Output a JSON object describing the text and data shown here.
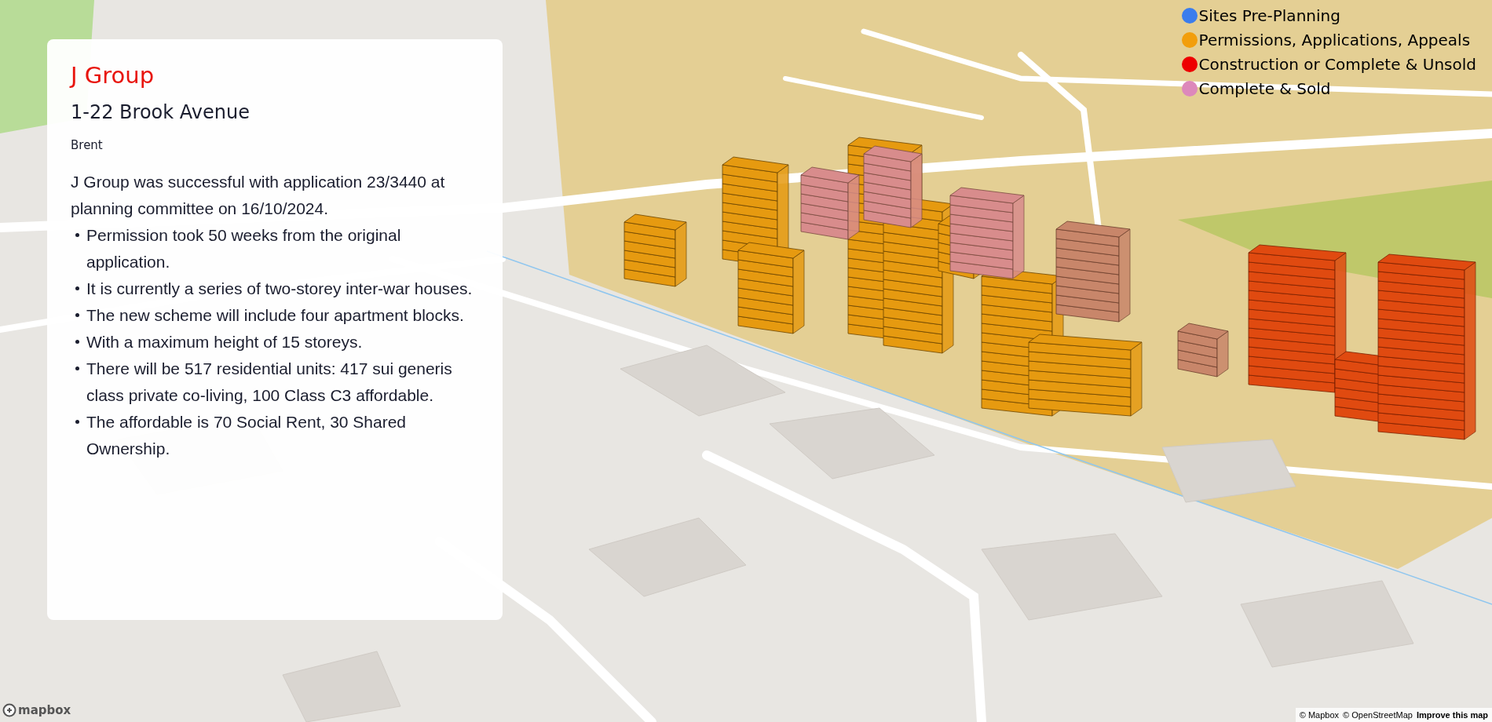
{
  "info_panel": {
    "developer": "J Group",
    "address": "1-22 Brook Avenue",
    "borough": "Brent",
    "summary": "J Group was successful with application 23/3440 at planning committee on 16/10/2024.",
    "bullets": [
      "Permission took 50 weeks from the original application.",
      "It is currently a series of two-storey inter-war houses.",
      "The new scheme will include four apartment blocks.",
      "With a maximum height of 15 storeys.",
      "There will be 517 residential units: 417 sui generis class private co-living, 100 Class C3 affordable.",
      "The affordable is 70 Social Rent, 30 Shared Ownership."
    ]
  },
  "legend": [
    {
      "label": "Sites Pre-Planning",
      "color": "#3b7ded"
    },
    {
      "label": "Permissions, Applications, Appeals",
      "color": "#f29e0c"
    },
    {
      "label": "Construction or Complete & Unsold",
      "color": "#ee0000"
    },
    {
      "label": "Complete & Sold",
      "color": "#dd88bb"
    }
  ],
  "map_logo": "mapbox",
  "attribution": [
    "© Mapbox",
    "© OpenStreetMap",
    "Improve this map"
  ]
}
